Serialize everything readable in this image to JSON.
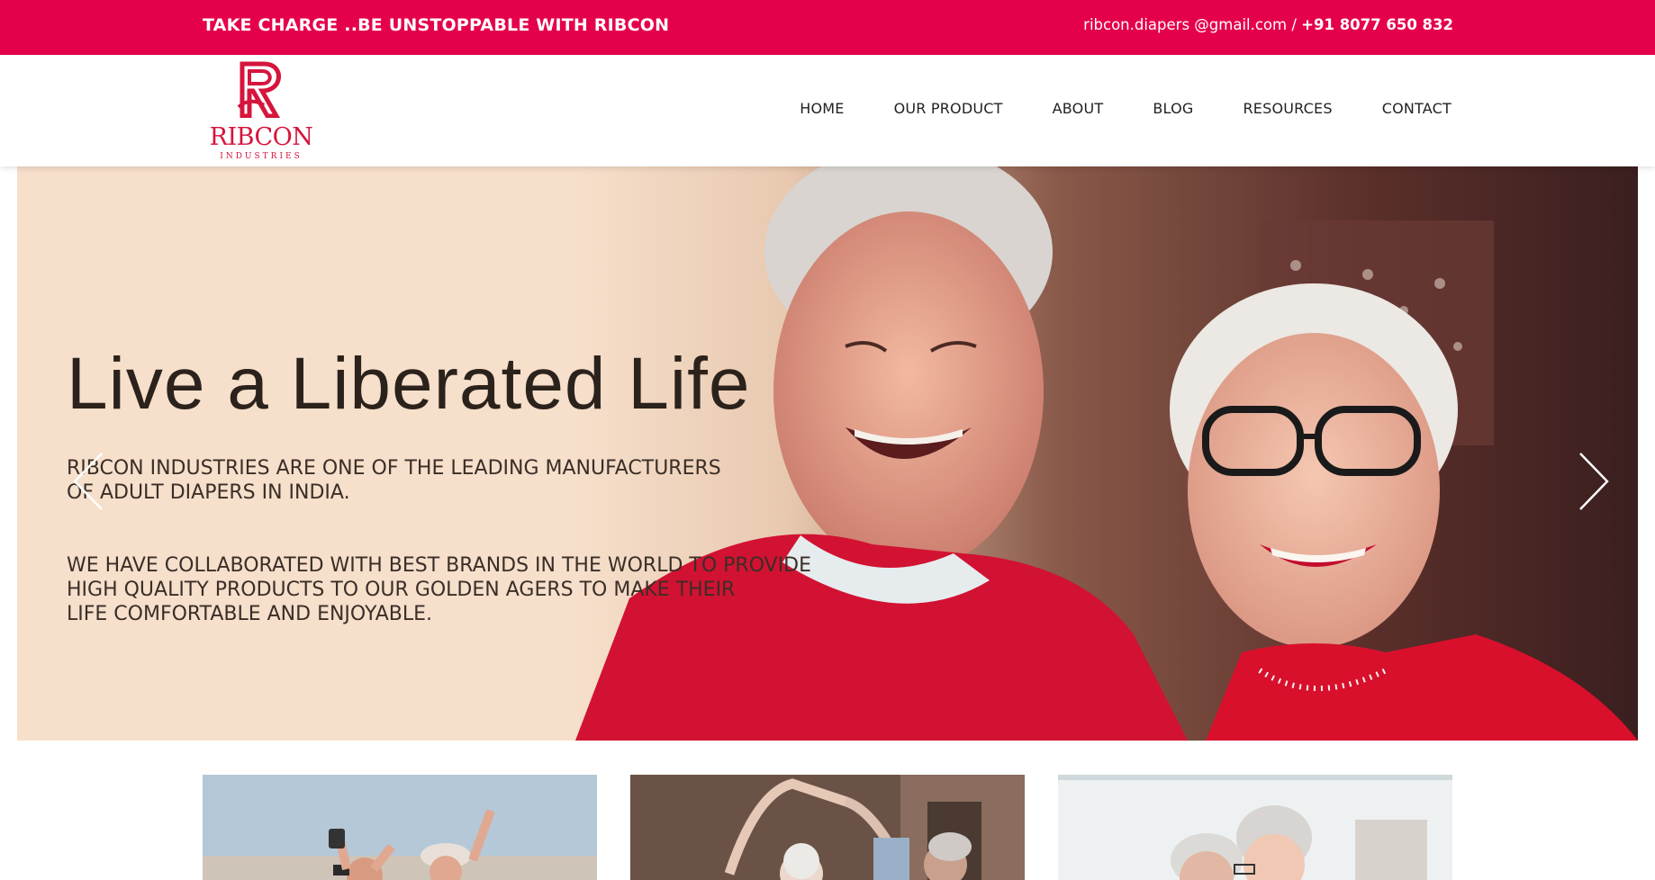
{
  "topbar": {
    "tagline": "TAKE CHARGE ..BE UNSTOPPABLE WITH RIBCON",
    "email": "ribcon.diapers @gmail.com",
    "separator": " / ",
    "phone": "+91 8077 650 832"
  },
  "brand": {
    "name": "RIBCON",
    "subtitle": "INDUSTRIES",
    "color": "#d7143c",
    "accent": "#e5004b"
  },
  "nav": {
    "items": [
      {
        "label": "HOME"
      },
      {
        "label": "OUR PRODUCT"
      },
      {
        "label": "ABOUT"
      },
      {
        "label": "BLOG"
      },
      {
        "label": "RESOURCES"
      },
      {
        "label": "CONTACT"
      }
    ]
  },
  "hero": {
    "title": "Live a Liberated Life",
    "paragraph1": "RIBCON INDUSTRIES ARE ONE OF THE LEADING MANUFACTURERS\nOF ADULT DIAPERS IN INDIA.",
    "paragraph2": "WE HAVE COLLABORATED WITH BEST BRANDS IN THE WORLD TO PROVIDE\nHIGH QUALITY PRODUCTS TO OUR GOLDEN AGERS TO MAKE THEIR\nLIFE COMFORTABLE AND ENJOYABLE.",
    "prev_icon": "chevron-left-icon",
    "next_icon": "chevron-right-icon"
  },
  "cards": [
    {
      "image": "seniors-celebrating-outdoors-photo"
    },
    {
      "image": "seniors-dancing-photo"
    },
    {
      "image": "senior-couple-embracing-photo"
    }
  ]
}
